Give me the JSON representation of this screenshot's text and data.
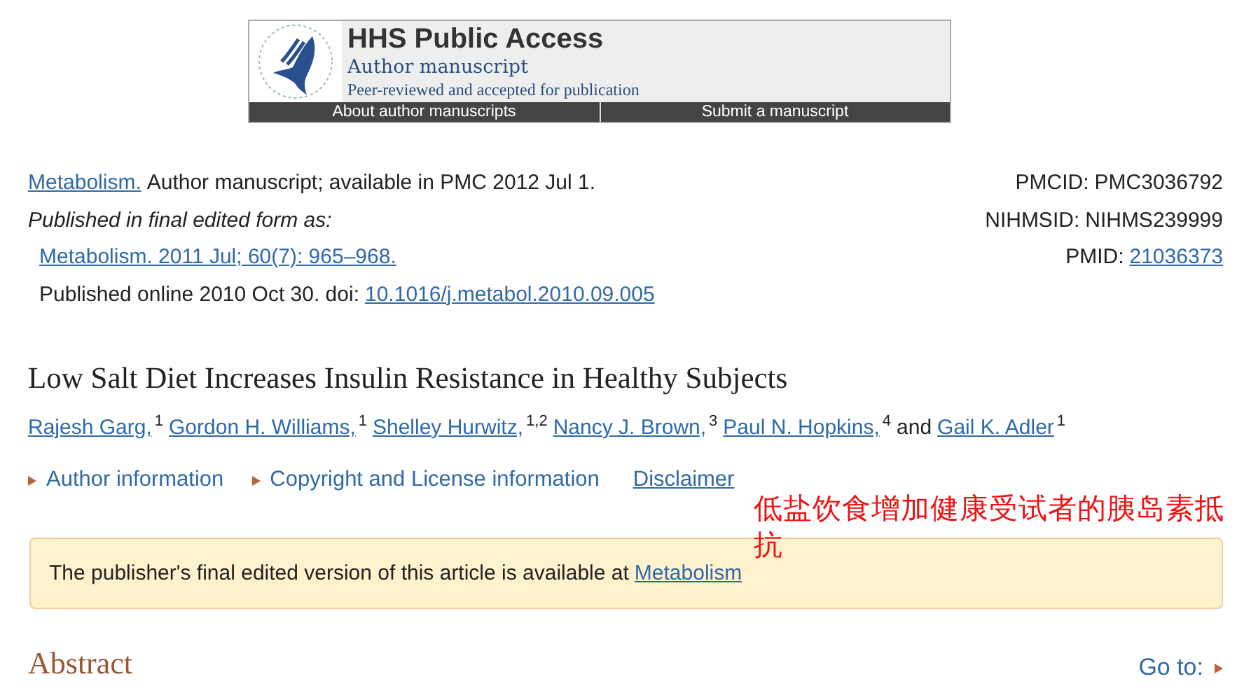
{
  "banner": {
    "title": "HHS Public Access",
    "subtitle": "Author manuscript",
    "tagline": "Peer-reviewed and accepted for publication",
    "nav_links": [
      {
        "label": "About author manuscripts"
      },
      {
        "label": "Submit a manuscript"
      }
    ]
  },
  "citation": {
    "journal_link": "Metabolism.",
    "availability": "Author manuscript; available in PMC 2012 Jul 1.",
    "published_label": "Published in final edited form as:",
    "published_link": "Metabolism. 2011 Jul; 60(7): 965–968.",
    "online_text": "Published online 2010 Oct 30. doi:",
    "doi_link": "10.1016/j.metabol.2010.09.005"
  },
  "ids": [
    {
      "label": "PMCID:",
      "value": "PMC3036792",
      "linked": false
    },
    {
      "label": "NIHMSID:",
      "value": "NIHMS239999",
      "linked": false
    },
    {
      "label": "PMID:",
      "value": "21036373",
      "linked": true
    }
  ],
  "article_title": "Low Salt Diet Increases Insulin Resistance in Healthy Subjects",
  "authors": [
    {
      "name": "Rajesh Garg,",
      "affiliations": "1"
    },
    {
      "name": "Gordon H. Williams,",
      "affiliations": "1"
    },
    {
      "name": "Shelley Hurwitz,",
      "affiliations": "1,2"
    },
    {
      "name": "Nancy J. Brown,",
      "affiliations": "3"
    },
    {
      "name": "Paul N. Hopkins,",
      "affiliations": "4"
    },
    {
      "name": "Gail K. Adler",
      "affiliations": "1"
    }
  ],
  "authors_conjunction": "and",
  "info_links": [
    {
      "label": "Author information",
      "kind": "expander"
    },
    {
      "label": "Copyright and License information",
      "kind": "expander"
    },
    {
      "label": "Disclaimer",
      "kind": "link"
    }
  ],
  "annotation": "低盐饮食增加健康受试者的胰岛素抵抗",
  "notice": {
    "text": "The publisher's final edited version of this article is available at",
    "link": "Metabolism"
  },
  "section": {
    "title": "Abstract",
    "goto": "Go to:"
  }
}
